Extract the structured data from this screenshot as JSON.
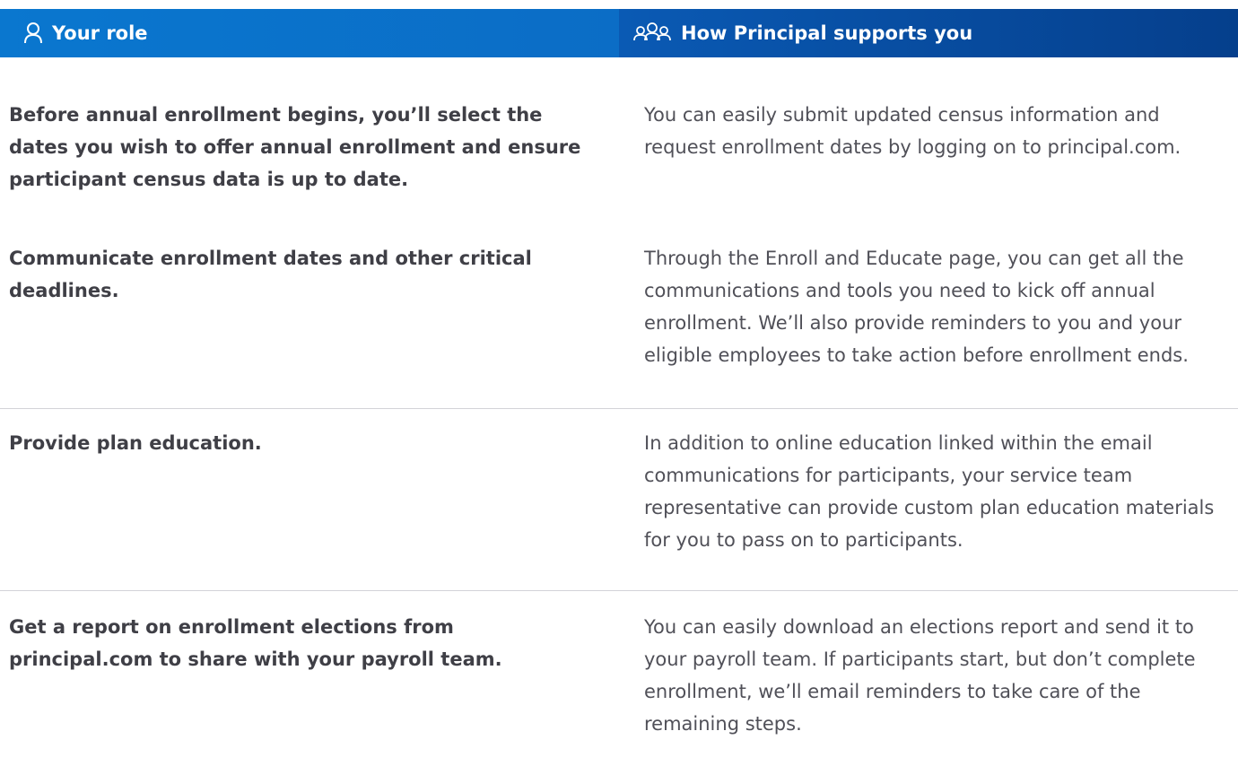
{
  "header": {
    "role_label": "Your role",
    "support_label": "How Principal supports you",
    "role_icon": "person-icon",
    "support_icon": "group-icon",
    "left_color": "#0a77cf",
    "right_color": "#053f8c"
  },
  "rows": [
    {
      "role": "Before annual enrollment begins, you’ll select the dates you wish to offer annual enrollment and ensure participant census data is up to date.",
      "support": "You can easily submit updated census information and request enrollment dates by logging on to principal.com."
    },
    {
      "role": "Communicate enrollment dates and other critical deadlines.",
      "support": "Through the Enroll and Educate page,  you can get all the communications and tools you need to kick off annual enrollment. We’ll also provide reminders to you and your eligible employees to take action before enrollment ends."
    },
    {
      "role": "Provide plan education.",
      "support": "In addition to online education linked within the email communications for participants, your service team representative can provide custom plan education materials for you to pass on to participants."
    },
    {
      "role": "Get a report on enrollment elections from principal.com to share with your payroll team.",
      "support": "You can easily download an elections report and send it to your payroll team. If participants start, but don’t complete enrollment, we’ll email reminders to take care of the remaining steps."
    }
  ]
}
